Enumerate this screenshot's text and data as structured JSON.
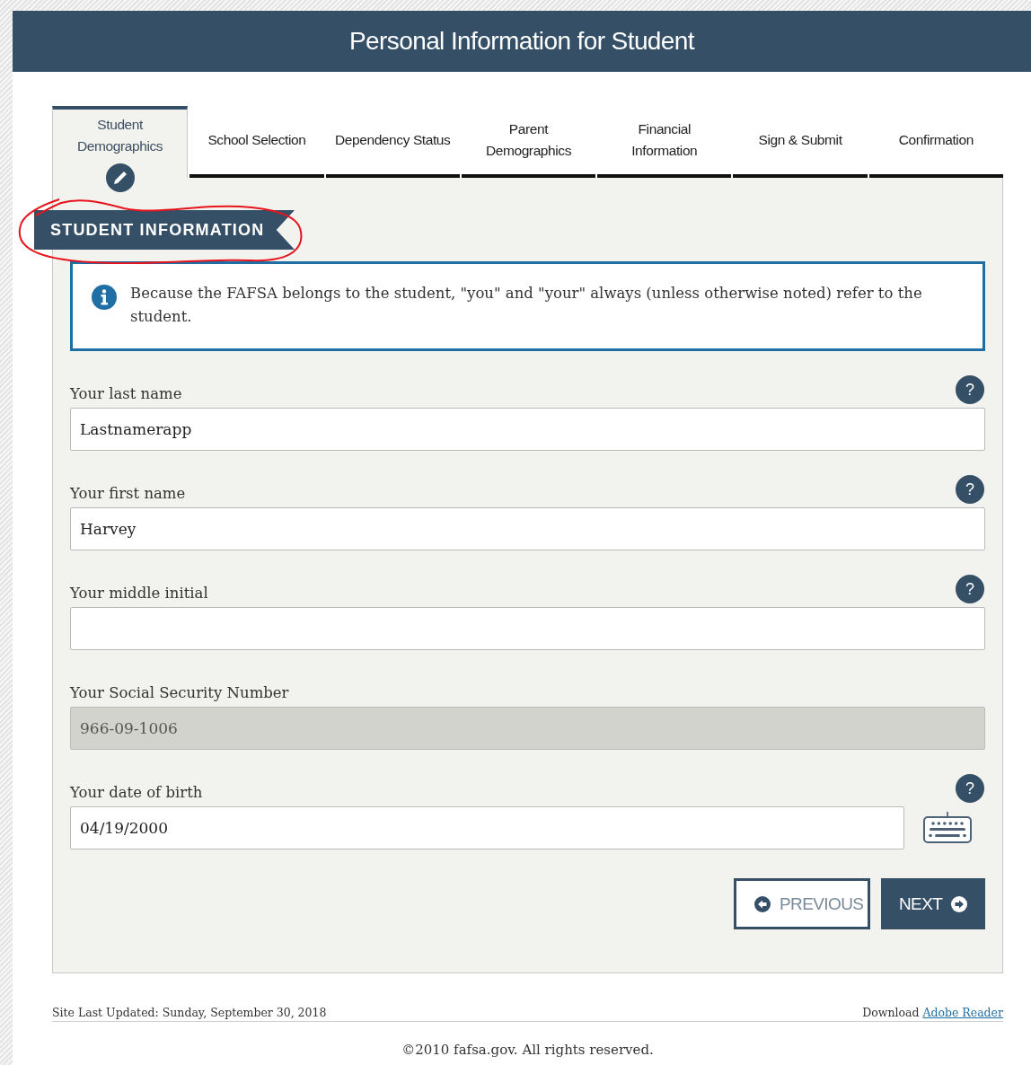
{
  "header": {
    "title": "Personal Information for Student"
  },
  "tabs": [
    {
      "label": "Student\nDemographics",
      "selected": true
    },
    {
      "label": "School Selection",
      "selected": false
    },
    {
      "label": "Dependency Status",
      "selected": false
    },
    {
      "label": "Parent\nDemographics",
      "selected": false
    },
    {
      "label": "Financial\nInformation",
      "selected": false
    },
    {
      "label": "Sign & Submit",
      "selected": false
    },
    {
      "label": "Confirmation",
      "selected": false
    }
  ],
  "section": {
    "title": "STUDENT INFORMATION"
  },
  "notice": {
    "text": "Because the FAFSA belongs to the student, \"you\" and \"your\" always (unless otherwise noted) refer to the student."
  },
  "fields": [
    {
      "kind": "text",
      "label": "Your last name",
      "value": "Lastnamerapp",
      "help": "?",
      "disabled": false
    },
    {
      "kind": "text",
      "label": "Your first name",
      "value": "Harvey",
      "help": "?",
      "disabled": false
    },
    {
      "kind": "text",
      "label": "Your middle initial",
      "help": "?",
      "disabled": false
    },
    {
      "kind": "text",
      "label": "Your Social Security Number",
      "value": "966-09-1006",
      "disabled": true
    },
    {
      "kind": "date",
      "label": "Your date of birth",
      "value": "04/19/2000",
      "help": "?",
      "disabled": false
    }
  ],
  "buttons": [
    {
      "kind": "previous",
      "label": "PREVIOUS"
    },
    {
      "kind": "next",
      "label": "NEXT"
    }
  ],
  "footer": {
    "updated": "Site Last Updated: Sunday, September 30, 2018",
    "download_text": "Download",
    "download_link": "Adobe Reader",
    "copyright": "©2010 fafsa.gov. All rights reserved."
  }
}
